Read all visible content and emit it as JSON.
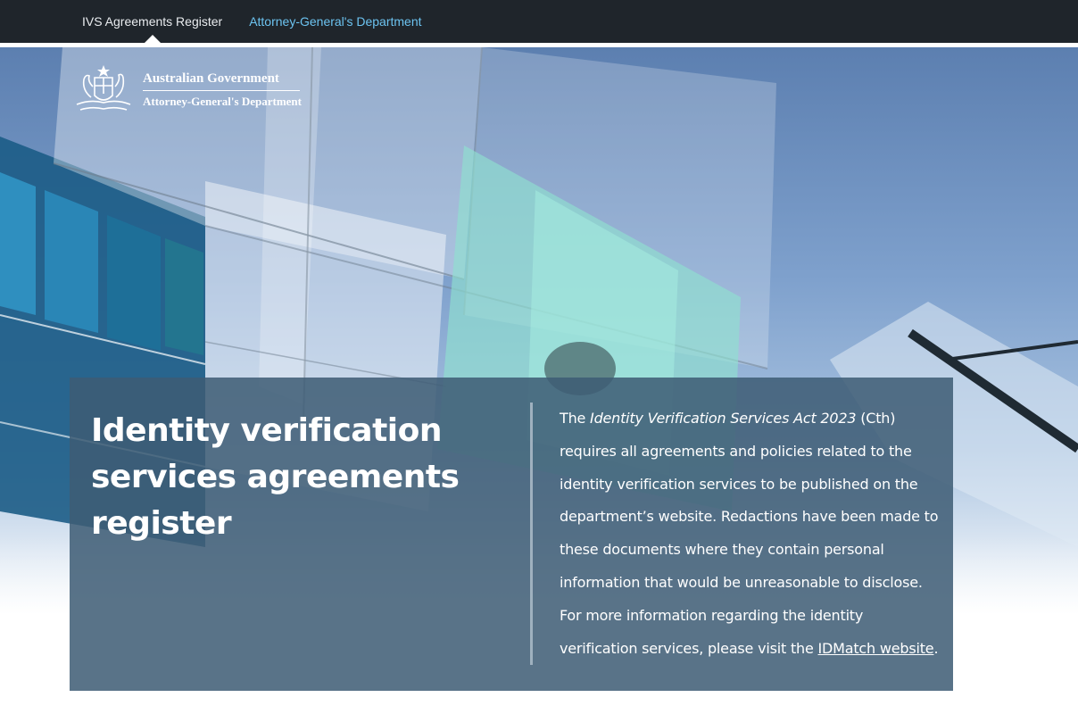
{
  "nav": {
    "active_label": "IVS Agreements Register",
    "link_label": "Attorney-General's Department"
  },
  "logo": {
    "line1": "Australian Government",
    "line2": "Attorney-General's Department"
  },
  "hero": {
    "title": "Identity verification services agreements register",
    "body": {
      "p1_prefix": "The ",
      "act_name": "Identity Verification Services Act 2023",
      "p1_suffix": " (Cth) requires all agreements and policies related to the identity verification services to be published on the department’s website. Redactions have been made to these documents where they contain personal information that would be unreasonable to disclose. For more information regarding the identity verification services, please visit the ",
      "link_text": "IDMatch website",
      "end": "."
    }
  },
  "colors": {
    "nav_bg": "#1f252b",
    "nav_link": "#6cc3f0",
    "panel_bg": "#3e5c74"
  },
  "icons": {
    "logo": "coat-of-arms-icon"
  }
}
